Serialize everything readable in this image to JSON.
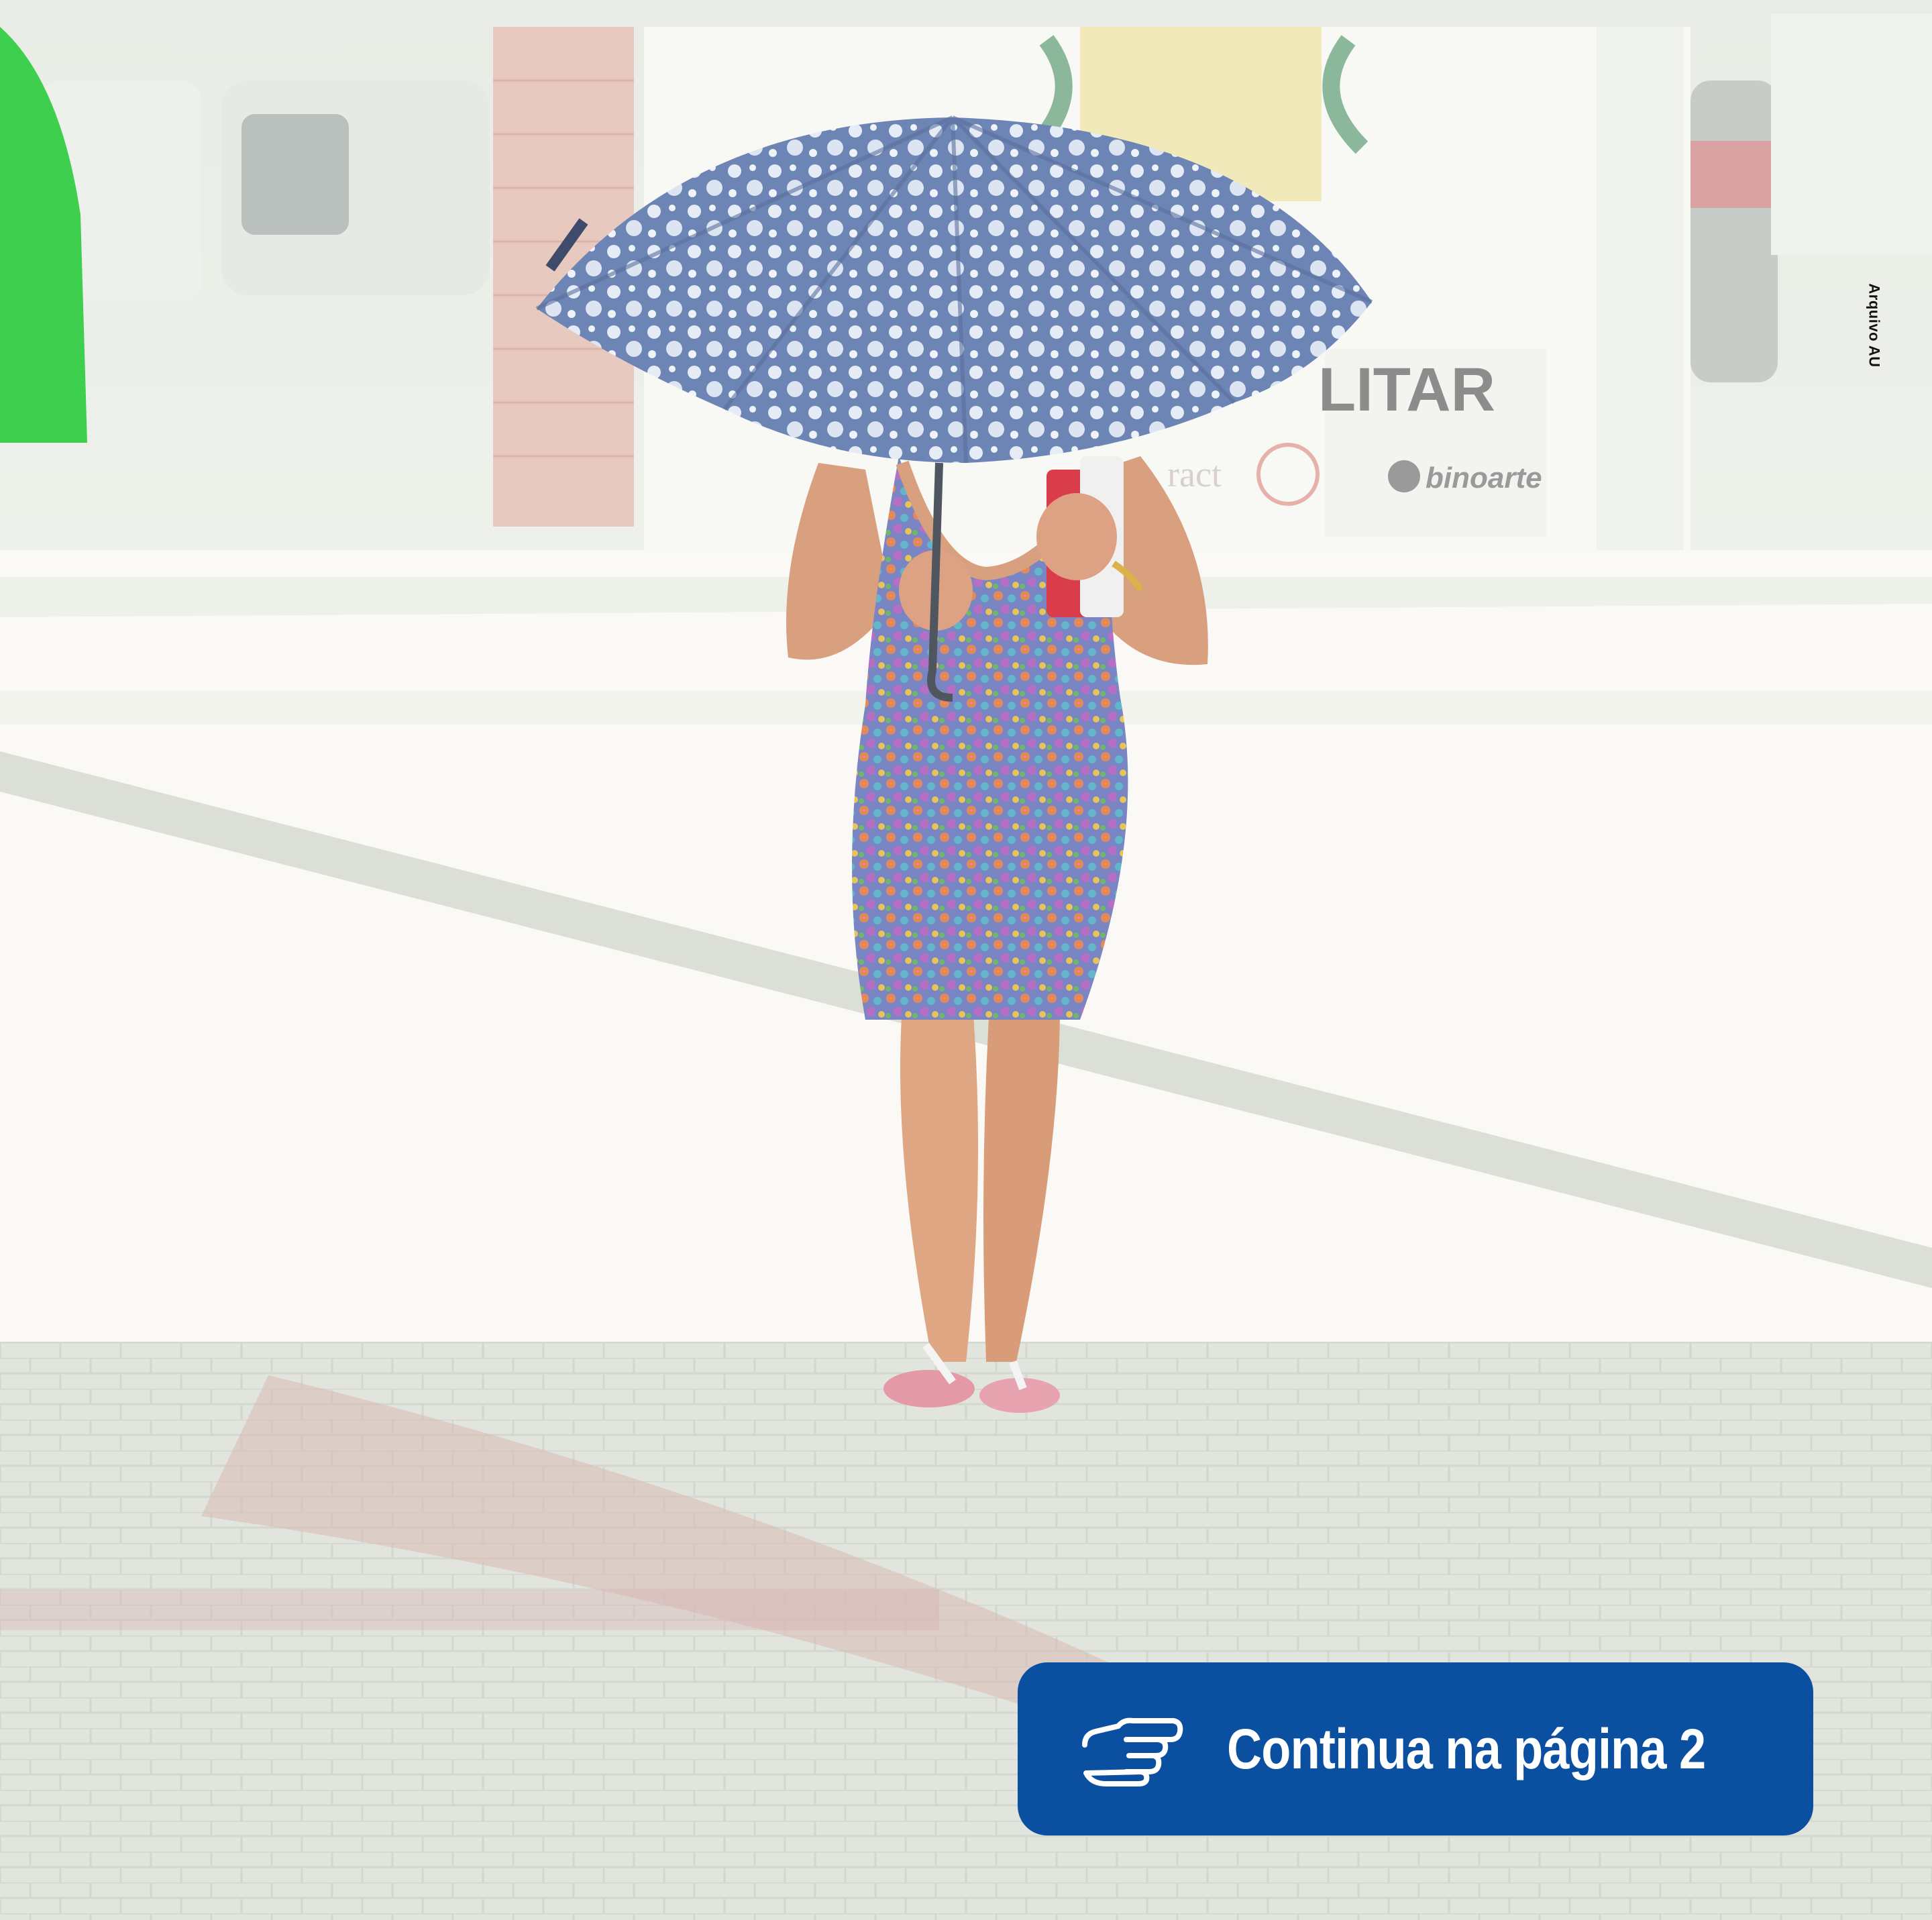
{
  "photo": {
    "credit": "Arquivo AU",
    "background_sign_text": "LITAR",
    "background_logo_text": "binoarte",
    "background_logo_text_2": "ract"
  },
  "continue_button": {
    "label": "Continua na página 2",
    "icon": "pointing-hand-icon",
    "color": "#0a4fa0"
  }
}
